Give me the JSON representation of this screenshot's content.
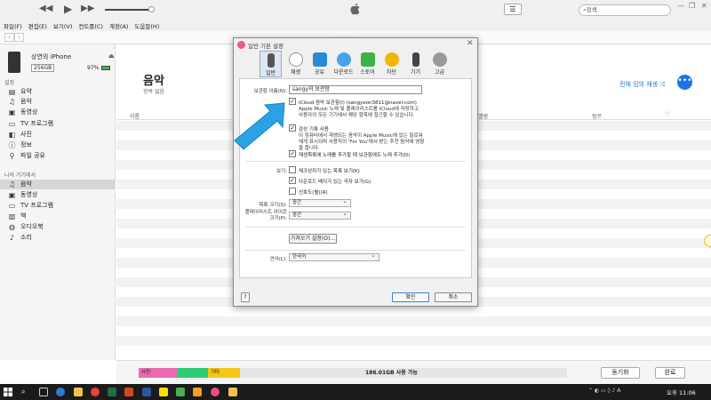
{
  "search": {
    "placeholder": "검색"
  },
  "menu": [
    "파일(F)",
    "편집(E)",
    "보기(V)",
    "컨트롤(C)",
    "계정(A)",
    "도움말(H)"
  ],
  "nav": {
    "faded_title": "상연의 iPhone"
  },
  "device": {
    "name": "상연의 iPhone",
    "capacity": "256GB",
    "battery": "97%"
  },
  "sidebar": {
    "section_settings": "설정",
    "settings_items": [
      {
        "label": "요약",
        "icon": "summary-icon"
      },
      {
        "label": "음악",
        "icon": "music-icon"
      },
      {
        "label": "동영상",
        "icon": "movie-icon"
      },
      {
        "label": "TV 프로그램",
        "icon": "tv-icon"
      },
      {
        "label": "사진",
        "icon": "photo-icon"
      },
      {
        "label": "정보",
        "icon": "info-icon"
      },
      {
        "label": "파일 공유",
        "icon": "file-share-icon"
      }
    ],
    "section_device": "나의 기기에서",
    "device_items": [
      {
        "label": "음악",
        "icon": "music-icon"
      },
      {
        "label": "동영상",
        "icon": "movie-icon"
      },
      {
        "label": "TV 프로그램",
        "icon": "tv-icon"
      },
      {
        "label": "책",
        "icon": "book-icon"
      },
      {
        "label": "오디오북",
        "icon": "audiobook-icon"
      },
      {
        "label": "소리",
        "icon": "bell-icon"
      }
    ]
  },
  "main": {
    "title": "음악",
    "subtitle": "항목 없음",
    "shuffle_label": "전체 임의 재생",
    "col_name": "이름",
    "col_album": "앨범",
    "col_genre": "장르"
  },
  "storage": {
    "photos_label": "사진",
    "other_label": "기타",
    "free_label": "186.01GB 사용 가능",
    "sync_button": "동기화",
    "done_button": "완료"
  },
  "dialog": {
    "title": "일반 기본 설정",
    "tabs": [
      "일반",
      "재생",
      "공유",
      "다운로드",
      "스토어",
      "차단",
      "기기",
      "고급"
    ],
    "library_name_label": "보관함 이름(N):",
    "library_name_value": "sangy의 보관함",
    "icloud_label": "iCloud 음악 보관함(I) (sangyeon3811@naver.com)",
    "icloud_desc": "Apple Music 노래 및 플레이리스트를 iCloud에 저장하고 사용자의 모든 기기에서 해당 항목에 접근할 수 있습니다.",
    "listening_label": "감상 기록 사용",
    "listening_desc": "이 컴퓨터에서 재생되는 음악이 Apple Music에 있는 팔로워에게 표시되며 사용자의 'For You'에서 받는 추천 음악에 영향을 줍니다.",
    "auto_add_label": "재생목록에 노래를 추가할 때 보관함에도 노래 추가(D)",
    "views_label": "보기:",
    "show_checked_label": "체크상자가 있는 목록 보기(K)",
    "show_download_label": "다운로드 배지가 있는 곡자 보기(G)",
    "show_stars_label": "선호도(별)(R)",
    "list_size_label": "목록 크기(S):",
    "list_size_value": "중간",
    "artwork_size_label": "플레이리스트 아이콘 크기(P):",
    "artwork_size_value": "중간",
    "import_button": "가져오기 설정(O)...",
    "language_label": "언어(L):",
    "language_value": "한국어",
    "help_button": "?",
    "ok_button": "확인",
    "cancel_button": "취소"
  },
  "taskbar": {
    "time": "오후 11:06",
    "lang": "A"
  },
  "colors": {
    "accent": "#1a73e8",
    "photos": "#e96ab1",
    "other": "#f5c518",
    "arrow": "#2aa3e6"
  }
}
